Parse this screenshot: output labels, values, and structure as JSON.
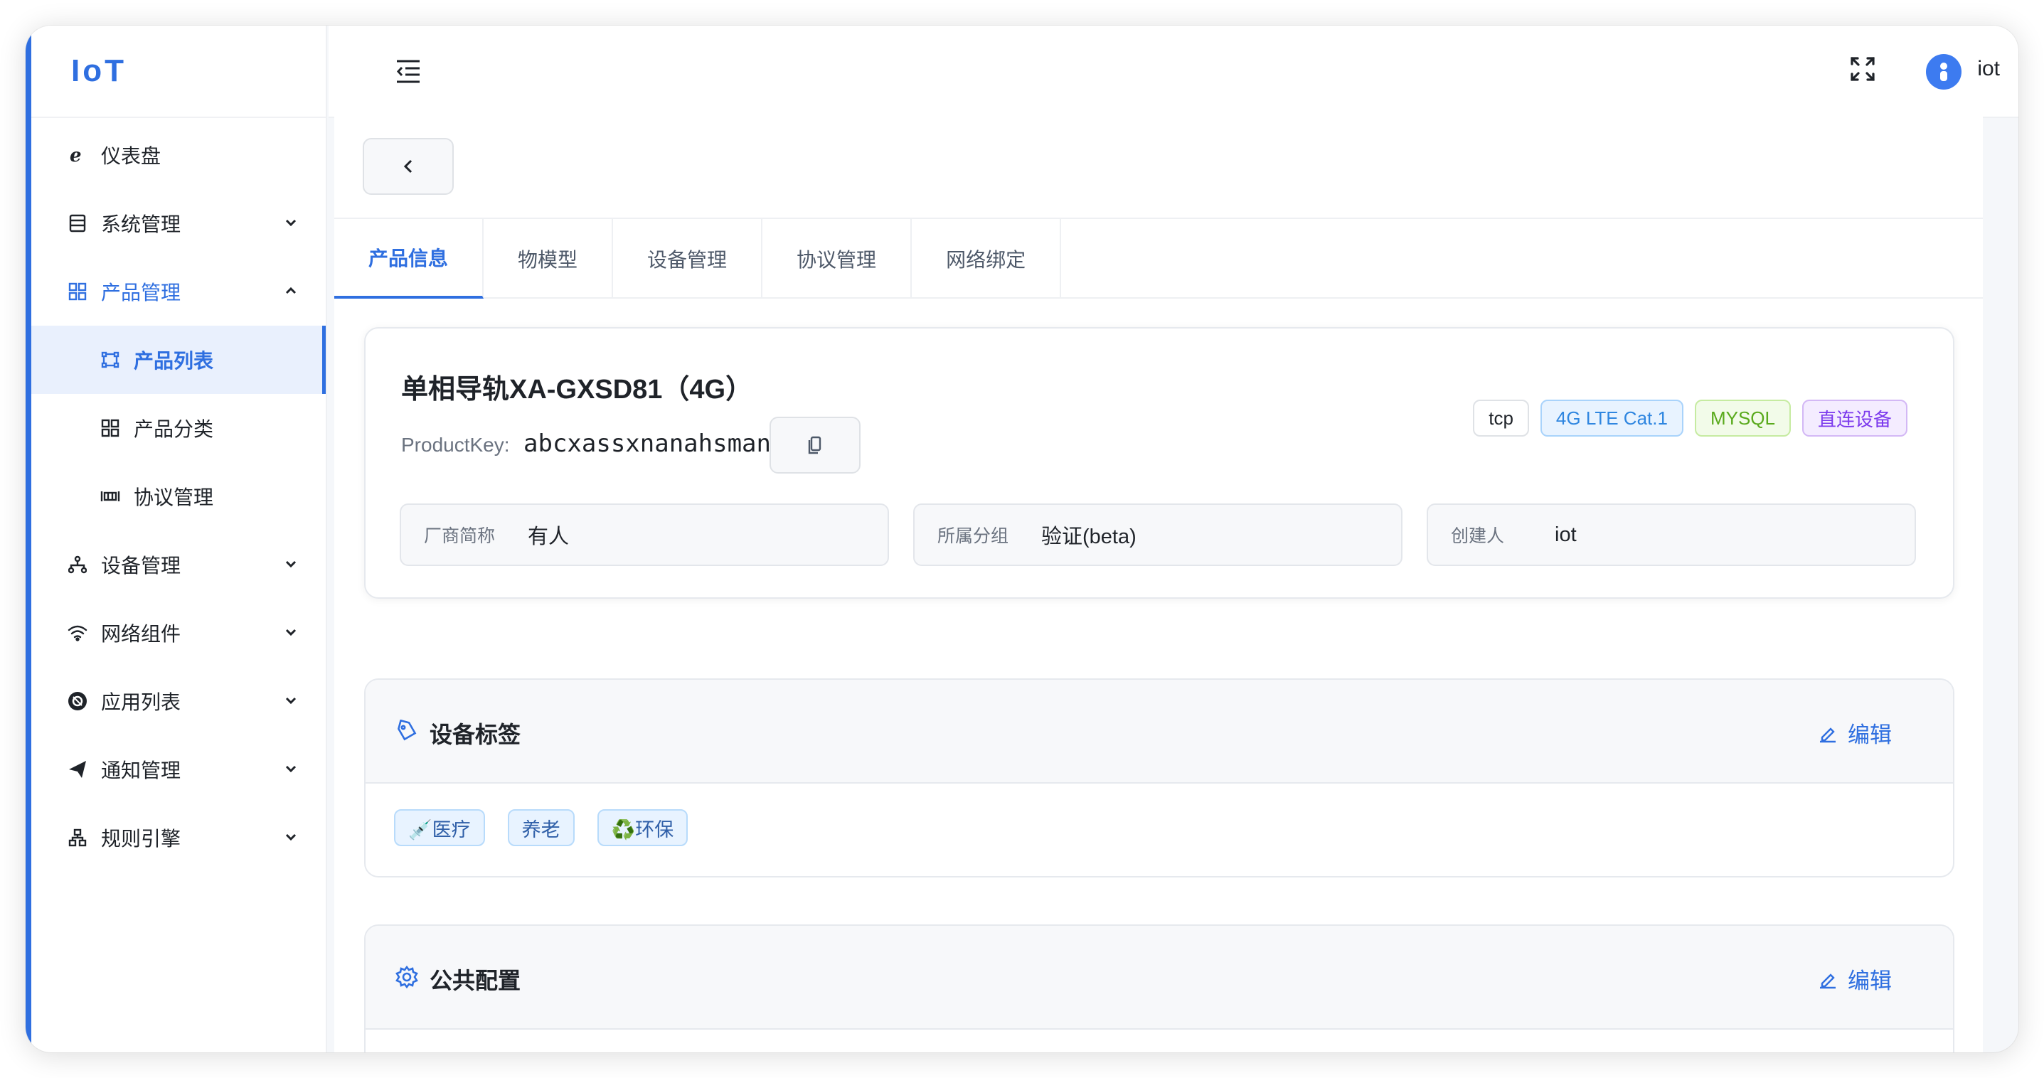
{
  "app": {
    "logo": "IoT"
  },
  "sidebar": {
    "items": [
      {
        "label": "仪表盘",
        "icon": "ie-icon"
      },
      {
        "label": "系统管理",
        "icon": "table-icon"
      },
      {
        "label": "产品管理",
        "icon": "grid-icon"
      },
      {
        "label": "产品列表",
        "icon": "nodes-icon"
      },
      {
        "label": "产品分类",
        "icon": "grid-icon"
      },
      {
        "label": "协议管理",
        "icon": "protocol-icon"
      },
      {
        "label": "设备管理",
        "icon": "hierarchy-icon"
      },
      {
        "label": "网络组件",
        "icon": "wifi-icon"
      },
      {
        "label": "应用列表",
        "icon": "app-icon"
      },
      {
        "label": "通知管理",
        "icon": "send-icon"
      },
      {
        "label": "规则引擎",
        "icon": "org-icon"
      }
    ]
  },
  "header": {
    "user": "iot"
  },
  "tabs": [
    "产品信息",
    "物模型",
    "设备管理",
    "协议管理",
    "网络绑定"
  ],
  "product": {
    "title": "单相导轨XA-GXSD81（4G）",
    "key_label": "ProductKey:",
    "key_value": "abcxassxnanahsman",
    "badges": [
      "tcp",
      "4G LTE Cat.1",
      "MYSQL",
      "直连设备"
    ],
    "fields": [
      {
        "label": "厂商简称",
        "value": "有人"
      },
      {
        "label": "所属分组",
        "value": "验证(beta)"
      },
      {
        "label": "创建人",
        "value": "iot"
      }
    ]
  },
  "tags_section": {
    "title": "设备标签",
    "edit": "编辑",
    "tags": [
      "💉医疗",
      "养老",
      "♻️环保"
    ]
  },
  "config_section": {
    "title": "公共配置",
    "edit": "编辑"
  },
  "colors": {
    "accent": "#2f6fe0"
  }
}
